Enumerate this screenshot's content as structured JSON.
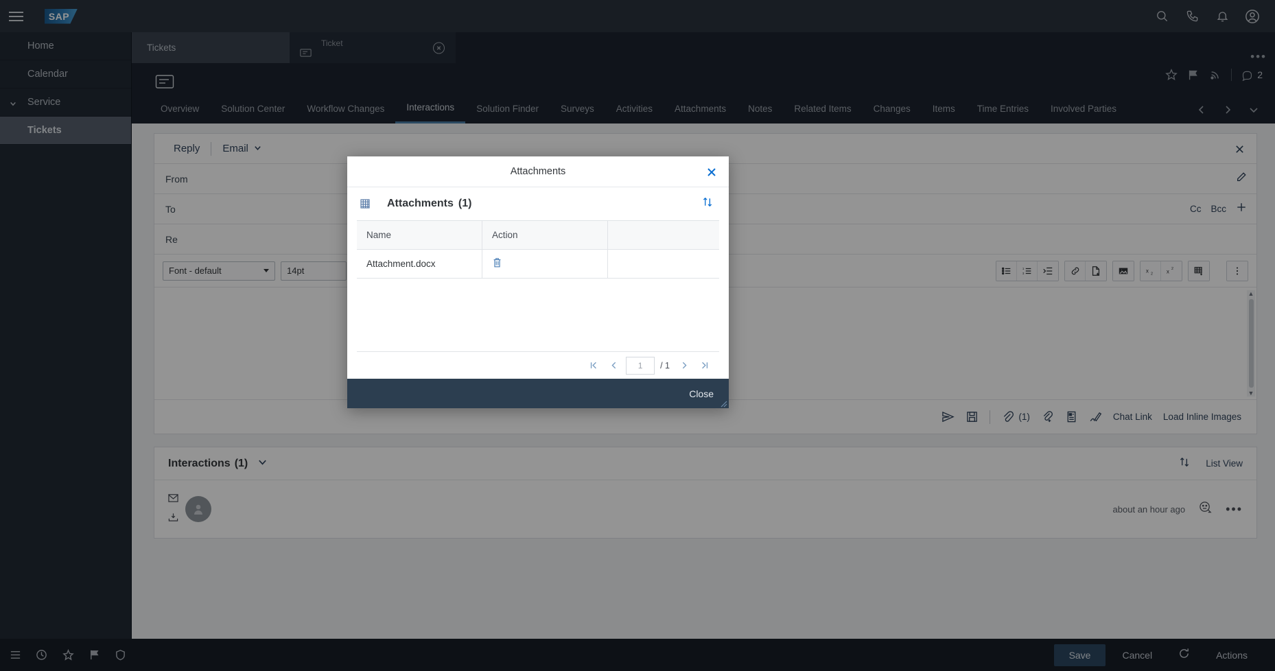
{
  "topbar": {
    "logo_text": "SAP",
    "icons": [
      "search-icon",
      "phone-icon",
      "bell-icon",
      "user-icon"
    ]
  },
  "sidebar": {
    "items": [
      {
        "label": "Home",
        "type": "item"
      },
      {
        "label": "Calendar",
        "type": "item"
      },
      {
        "label": "Service",
        "type": "group"
      },
      {
        "label": "Tickets",
        "type": "sub",
        "selected": true
      }
    ],
    "footer_icons": [
      "menu-icon",
      "clock-icon",
      "star-icon",
      "flag-icon",
      "shield-icon"
    ]
  },
  "tabstrip": {
    "tickets_tab": "Tickets",
    "ticket_tab": "Ticket"
  },
  "object_header": {
    "note_count": "2"
  },
  "nav_tabs": [
    {
      "label": "Overview",
      "active": false
    },
    {
      "label": "Solution Center",
      "active": false
    },
    {
      "label": "Workflow Changes",
      "active": false
    },
    {
      "label": "Interactions",
      "active": true
    },
    {
      "label": "Solution Finder",
      "active": false
    },
    {
      "label": "Surveys",
      "active": false
    },
    {
      "label": "Activities",
      "active": false
    },
    {
      "label": "Attachments",
      "active": false
    },
    {
      "label": "Notes",
      "active": false
    },
    {
      "label": "Related Items",
      "active": false
    },
    {
      "label": "Changes",
      "active": false
    },
    {
      "label": "Items",
      "active": false
    },
    {
      "label": "Time Entries",
      "active": false
    },
    {
      "label": "Involved Parties",
      "active": false
    }
  ],
  "compose": {
    "reply_label": "Reply",
    "channel_label": "Email",
    "fields": [
      {
        "label": "From",
        "value": ""
      },
      {
        "label": "To",
        "value": ""
      },
      {
        "label": "Re",
        "value": ""
      }
    ],
    "cc_label": "Cc",
    "bcc_label": "Bcc",
    "font_family": "Font - default",
    "font_size": "14pt",
    "editor_placeholder": "",
    "toolbar_icons": [
      "bullet-list-icon",
      "numbered-list-icon",
      "indent-icon",
      "link-icon",
      "insert-file-icon",
      "insert-image-icon",
      "subscript-icon",
      "superscript-icon",
      "insert-table-icon",
      "overflow-menu-icon"
    ],
    "actions": {
      "send": "send-icon",
      "save_draft": "save-icon",
      "attachments_count": "(1)",
      "chat_link": "Chat Link",
      "load_inline_images": "Load Inline Images"
    }
  },
  "interactions": {
    "title": "Interactions",
    "count": "(1)",
    "list_view_label": "List View",
    "rows": [
      {
        "time": "about an hour ago"
      }
    ]
  },
  "bottombar": {
    "save": "Save",
    "cancel": "Cancel",
    "refresh": "refresh-icon",
    "actions": "Actions"
  },
  "modal": {
    "window_title": "Attachments",
    "table_title": "Attachments",
    "table_count": "(1)",
    "columns": [
      "Name",
      "Action",
      ""
    ],
    "rows": [
      {
        "name": "Attachment.docx",
        "action": "delete-icon"
      }
    ],
    "pager": {
      "first": "|<",
      "prev": "<",
      "page_value": "1",
      "total": "/ 1",
      "next": ">",
      "last": ">|"
    },
    "close_label": "Close",
    "accent_color": "#0a6ed1",
    "footer_color": "#2c3e50"
  }
}
